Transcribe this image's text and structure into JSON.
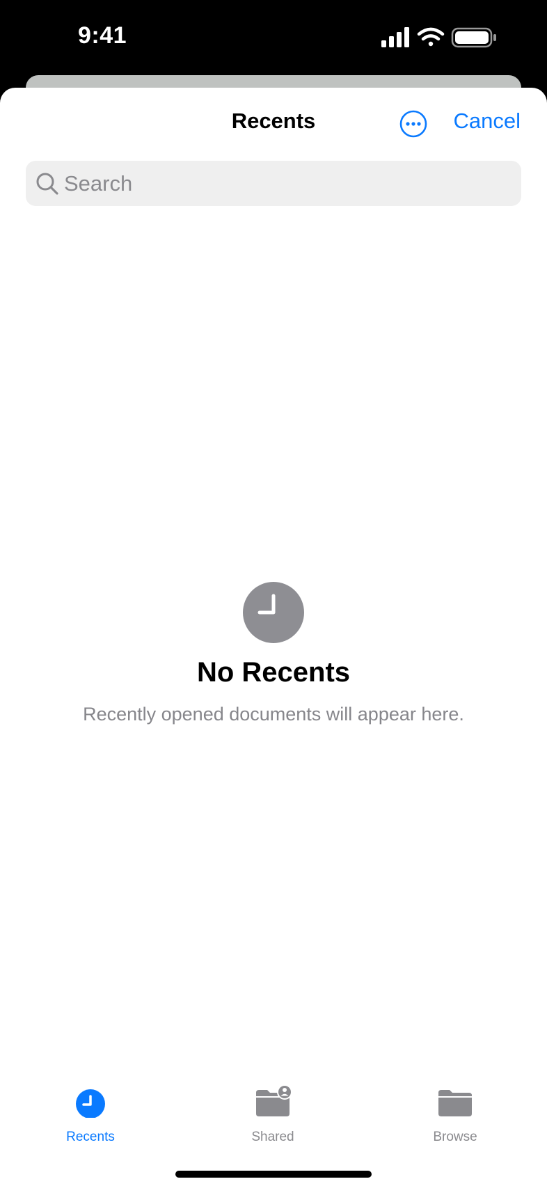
{
  "status_bar": {
    "time": "9:41"
  },
  "header": {
    "title": "Recents",
    "cancel_label": "Cancel",
    "more_icon": "ellipsis-circle-icon"
  },
  "search": {
    "placeholder": "Search",
    "value": ""
  },
  "empty_state": {
    "icon": "clock-icon",
    "title": "No Recents",
    "subtitle": "Recently opened documents will appear here."
  },
  "tab_bar": {
    "tabs": [
      {
        "label": "Recents",
        "icon": "clock-icon",
        "active": true
      },
      {
        "label": "Shared",
        "icon": "shared-folder-icon",
        "active": false
      },
      {
        "label": "Browse",
        "icon": "folder-icon",
        "active": false
      }
    ]
  },
  "colors": {
    "accent": "#0a7aff",
    "inactive": "#8a8a8e",
    "empty_icon": "#8e8e93",
    "search_bg": "#efefef"
  }
}
